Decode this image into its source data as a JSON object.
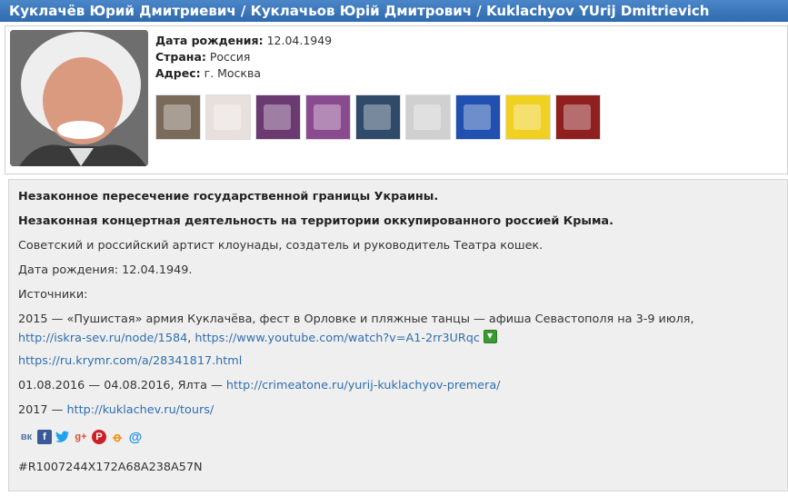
{
  "title": "Куклачёв Юрий Дмитриевич / Куклачьов Юрій Дмитрович / Kuklachyov YUrij Dmitrievich",
  "profile": {
    "birth_label": "Дата рождения:",
    "birth_value": "12.04.1949",
    "country_label": "Страна:",
    "country_value": "Россия",
    "address_label": "Адрес:",
    "address_value": "г. Москва"
  },
  "details": {
    "line1": "Незаконное пересечение государственной границы Украины.",
    "line2": "Незаконная концертная деятельность на территории оккупированного россией Крыма.",
    "line3": "Советский и российский артист клоунады, создатель и руководитель Театра кошек.",
    "line4": "Дата рождения: 12.04.1949.",
    "sources_label": "Источники:",
    "src2015_prefix": "2015 —  «Пушистая» армия Куклачёва, фест в Орловке и пляжные танцы — афиша Севастополя на 3-9 июля,",
    "src2015_link1": "http://iskra-sev.ru/node/1584",
    "src2015_sep": ", ",
    "src2015_link2": "https://www.youtube.com/watch?v=A1-2rr3URqc",
    "krymr_link": "https://ru.krymr.com/a/28341817.html",
    "src2016_prefix": " 01.08.2016 — 04.08.2016, Ялта — ",
    "src2016_link": "http://crimeatone.ru/yurij-kuklachyov-premera/",
    "src2017_prefix": "2017 — ",
    "src2017_link": "http://kuklachev.ru/tours/",
    "record_id": "#R1007244X172A68A238A57N"
  },
  "share_icons": [
    "vk-icon",
    "facebook-icon",
    "twitter-icon",
    "googleplus-icon",
    "pinterest-icon",
    "odnoklassniki-icon",
    "mail-icon"
  ],
  "thumb_colors": [
    "#7a6a5a",
    "#e8e0dc",
    "#6a3a70",
    "#8a4a90",
    "#304a6a",
    "#d0d0d0",
    "#2050b0",
    "#f0d020",
    "#902020"
  ]
}
